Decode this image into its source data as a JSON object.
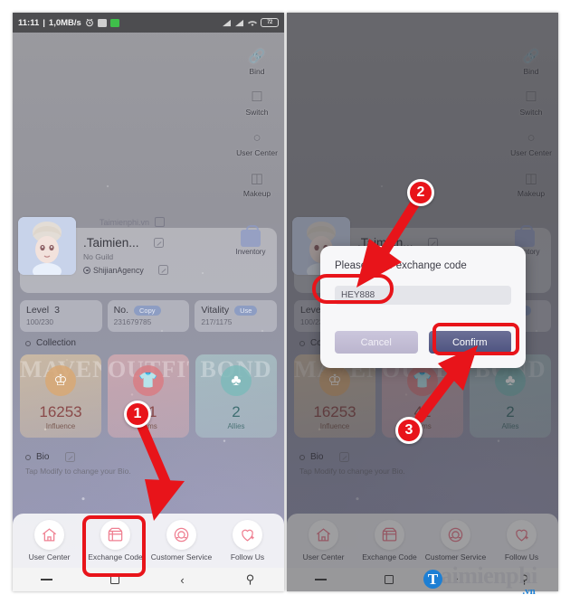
{
  "status_bar": {
    "time": "11:11",
    "separator": "|",
    "network_speed": "1,0MB/s",
    "icons": [
      "alarm-icon",
      "sim-chip-icon",
      "battery-saver-icon"
    ],
    "right_icons": [
      "signal-1-icon",
      "signal-2-icon",
      "wifi-icon"
    ],
    "battery": "72"
  },
  "side_menu": {
    "items": [
      {
        "label": "Bind",
        "icon": "link-icon"
      },
      {
        "label": "Switch",
        "icon": "switch-account-icon"
      },
      {
        "label": "User Center",
        "icon": "user-icon"
      },
      {
        "label": "Makeup",
        "icon": "makeup-icon"
      }
    ]
  },
  "profile": {
    "background_nickname": "Taimienphi.vn",
    "nickname": ".Taimien...",
    "guild": "No Guild",
    "agency": "ShijianAgency",
    "inventory_label": "Inventory",
    "avatar_name": "avatar"
  },
  "stats": [
    {
      "label": "Level",
      "value": "3",
      "sub": "100/230",
      "pill": ""
    },
    {
      "label": "No.",
      "value": "",
      "sub": "231679785",
      "pill": "Copy"
    },
    {
      "label": "Vitality",
      "value": "",
      "sub": "217/1175",
      "pill": "Use"
    }
  ],
  "collection": {
    "heading": "Collection",
    "cards": [
      {
        "ghost": "MAVEN",
        "number": "16253",
        "label": "Influence",
        "icon": "crown-icon"
      },
      {
        "ghost": "OUTFIT",
        "number": "41",
        "label": "Items",
        "icon": "tshirt-icon"
      },
      {
        "ghost": "BOND",
        "number": "2",
        "label": "Allies",
        "icon": "clover-icon"
      }
    ]
  },
  "bio": {
    "heading": "Bio",
    "text": "Tap Modify to change your Bio.",
    "edit_icon": "edit-icon"
  },
  "bottom_nav": [
    {
      "label": "User Center",
      "icon": "home-icon"
    },
    {
      "label": "Exchange Code",
      "icon": "exchange-code-icon"
    },
    {
      "label": "Customer Service",
      "icon": "headset-icon"
    },
    {
      "label": "Follow Us",
      "icon": "heart-plus-icon"
    }
  ],
  "android_nav": [
    {
      "name": "recents-button",
      "icon": "dash-icon"
    },
    {
      "name": "home-button",
      "icon": "square-icon"
    },
    {
      "name": "back-button",
      "icon": "chevron-left-icon"
    },
    {
      "name": "accessibility-button",
      "icon": "accessibility-icon"
    }
  ],
  "dialog": {
    "title": "Please enter exchange code",
    "input_value": "HEY888",
    "input_placeholder": "Please enter exchange code",
    "cancel_label": "Cancel",
    "confirm_label": "Confirm"
  },
  "annotations": {
    "markers": [
      {
        "number": "1",
        "target": "exchange-code-nav-item"
      },
      {
        "number": "2",
        "target": "exchange-code-input"
      },
      {
        "number": "3",
        "target": "confirm-button"
      }
    ],
    "accent_color": "#e8141a"
  },
  "watermark": {
    "logo_letter": "T",
    "text": "aimienphi",
    "tld": ".vn",
    "logo_color": "#1d7fd4"
  }
}
